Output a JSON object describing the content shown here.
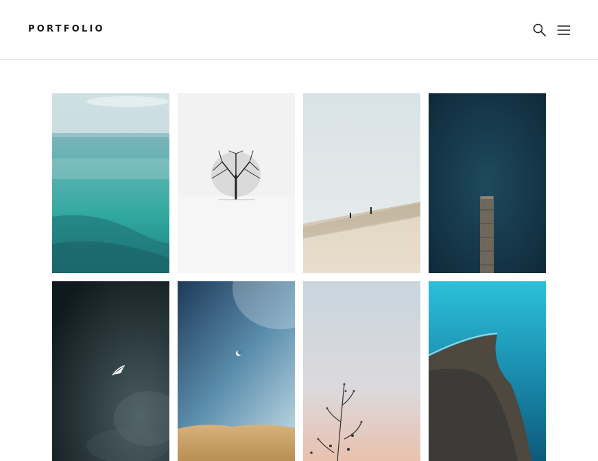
{
  "header": {
    "brand": "PORTFOLIO",
    "search_icon": "search-icon",
    "menu_icon": "hamburger-menu-icon"
  },
  "gallery": {
    "items": [
      {
        "name": "photo-turquoise-sea"
      },
      {
        "name": "photo-lone-tree"
      },
      {
        "name": "photo-sand-dune-hikers"
      },
      {
        "name": "photo-pier-dark-water"
      },
      {
        "name": "photo-boat-dark-sea"
      },
      {
        "name": "photo-moon-desert"
      },
      {
        "name": "photo-plant-sunset"
      },
      {
        "name": "photo-aerial-coast"
      }
    ]
  },
  "colors": {
    "text": "#1a1a1a",
    "divider": "#e6e6e6",
    "background": "#ffffff"
  }
}
